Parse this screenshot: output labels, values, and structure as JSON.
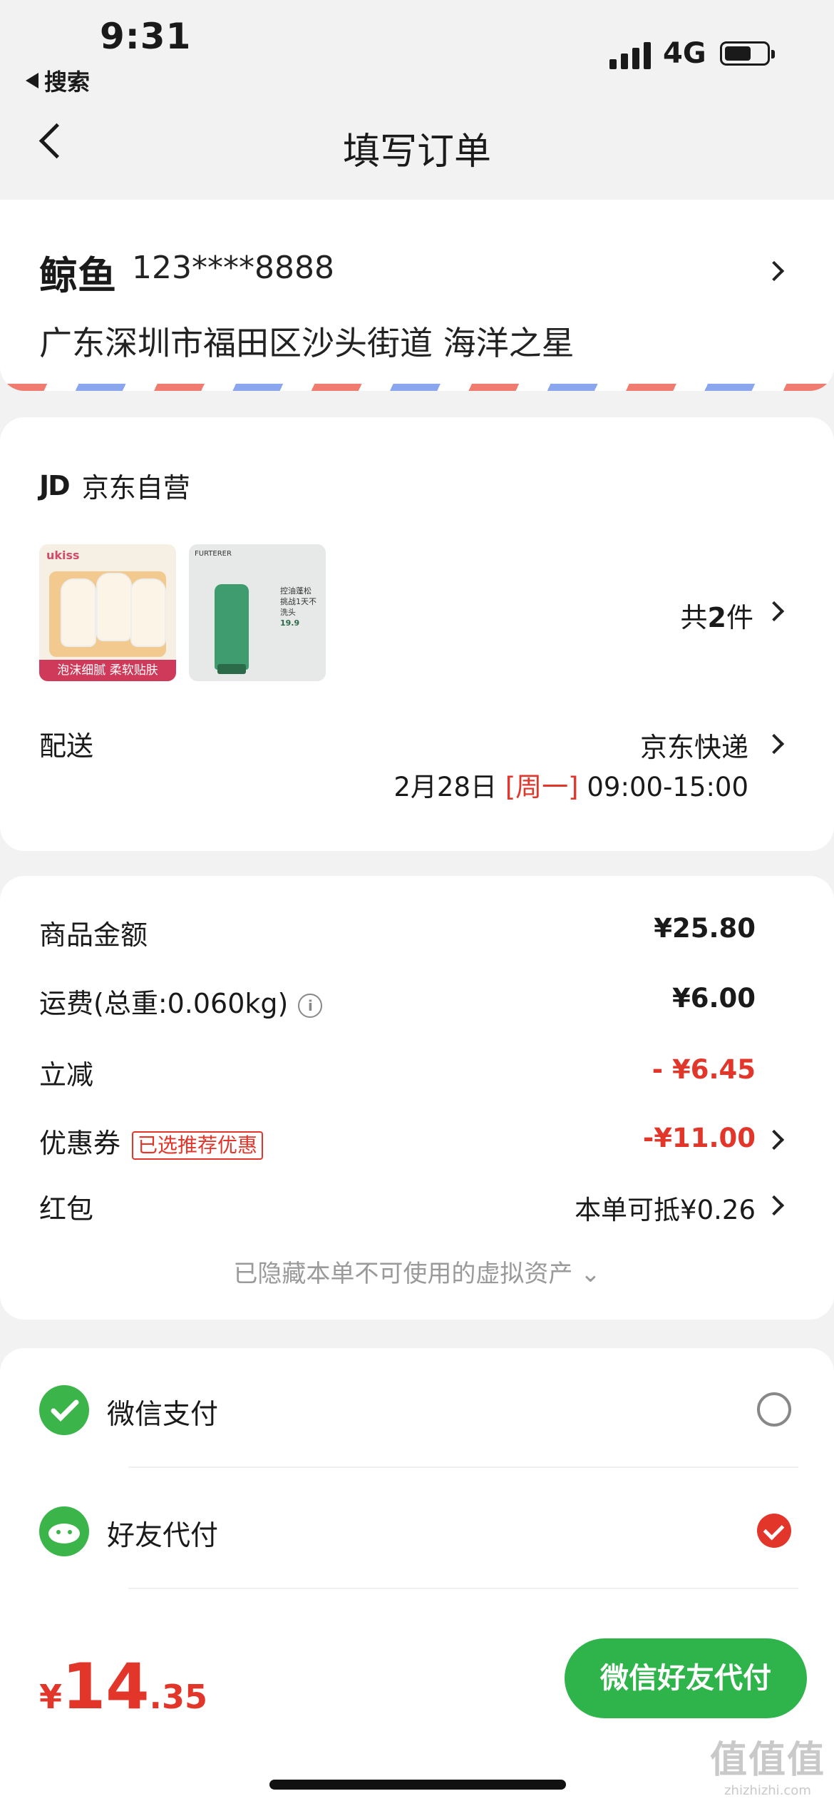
{
  "status_bar": {
    "time": "9:31",
    "back_app": "搜索",
    "network": "4G",
    "battery_level": 0.6
  },
  "header": {
    "title": "填写订单"
  },
  "address": {
    "name": "鲸鱼",
    "phone": "123****8888",
    "detail": "广东深圳市福田区沙头街道 海洋之星"
  },
  "shop": {
    "logo": "JD",
    "name": "京东自营",
    "products": [
      {
        "brand": "ukiss",
        "banner": "泡沫细腻 柔软贴肤"
      },
      {
        "brand": "FURTERER",
        "text": "控油蓬松 挑战1天不洗头",
        "price": "19.9"
      }
    ],
    "quantity_prefix": "共",
    "quantity": "2",
    "quantity_suffix": "件",
    "delivery_label": "配送",
    "carrier": "京东快递",
    "delivery_date": "2月28日",
    "delivery_weekday": "[周一]",
    "delivery_window": "09:00-15:00"
  },
  "pricing": {
    "goods_label": "商品金额",
    "goods_value": "¥25.80",
    "shipping_label": "运费(总重:0.060kg)",
    "shipping_value": "¥6.00",
    "discount_label": "立减",
    "discount_value": "- ¥6.45",
    "coupon_label": "优惠券",
    "coupon_tag": "已选推荐优惠",
    "coupon_value": "-¥11.00",
    "redpacket_label": "红包",
    "redpacket_value": "本单可抵¥0.26",
    "hidden_assets": "已隐藏本单不可使用的虚拟资产 ⌄"
  },
  "payment": {
    "options": [
      {
        "label": "微信支付",
        "selected": false,
        "icon": "wechat-pay-icon"
      },
      {
        "label": "好友代付",
        "selected": true,
        "icon": "friend-pay-icon"
      }
    ]
  },
  "bottom_bar": {
    "currency": "¥",
    "total_int": "14",
    "total_dec": ".35",
    "submit_label": "微信好友代付"
  },
  "watermark": {
    "big": "值值值",
    "small": "zhizhizhi.com"
  },
  "colors": {
    "accent_red": "#e2362b",
    "wechat_green": "#2fb44b"
  }
}
